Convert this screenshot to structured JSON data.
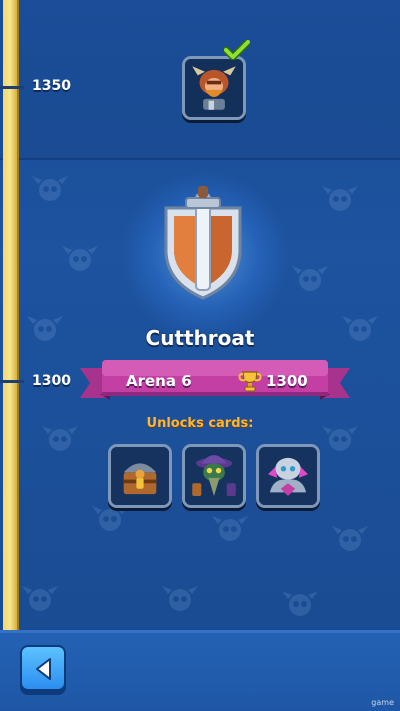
{
  "progress_track": {
    "milestones": [
      {
        "trophies": "1350",
        "completed": true
      },
      {
        "trophies": "1300",
        "completed": false
      }
    ]
  },
  "reward": {
    "icon": "barbarian-hero-card-icon",
    "claimed_icon": "checkmark-icon"
  },
  "arena": {
    "name": "Cutthroat",
    "label": "Arena 6",
    "trophies": "1300",
    "emblem_icon": "sword-shield-icon",
    "trophy_icon": "trophy-icon"
  },
  "unlocks": {
    "title": "Unlocks cards:",
    "cards": [
      {
        "icon": "treasure-chest-card-icon"
      },
      {
        "icon": "hooded-plague-doctor-card-icon"
      },
      {
        "icon": "crystal-golem-card-icon"
      }
    ]
  },
  "navigation": {
    "back_icon": "back-arrow-icon"
  },
  "watermark": "game",
  "colors": {
    "background": "#1c4e96",
    "track": "#f3d76a",
    "ribbon": "#c0399f",
    "ribbon_ribbon_fold": "#7d1f78",
    "unlocks_text": "#ffb52e",
    "back_button": "#2b8ef0",
    "checkmark": "#7ed321"
  }
}
